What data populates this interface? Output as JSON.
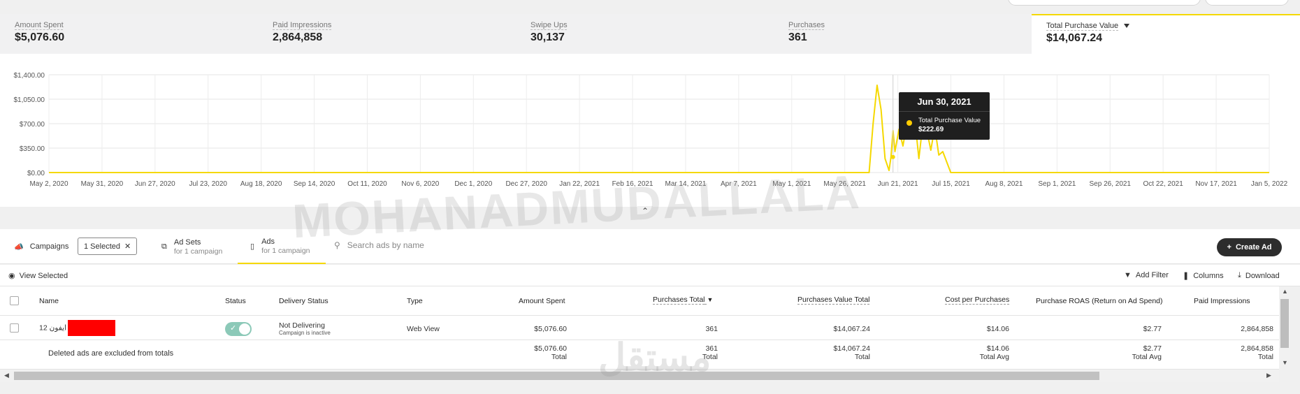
{
  "metrics": [
    {
      "label": "Amount Spent",
      "value": "$5,076.60"
    },
    {
      "label": "Paid Impressions",
      "value": "2,864,858"
    },
    {
      "label": "Swipe Ups",
      "value": "30,137"
    },
    {
      "label": "Purchases",
      "value": "361"
    },
    {
      "label": "Total Purchase Value",
      "value": "$14,067.24"
    }
  ],
  "chart_data": {
    "type": "line",
    "series": [
      {
        "name": "Total Purchase Value",
        "color": "#f5d800"
      }
    ],
    "y_ticks": [
      "$1,400.00",
      "$1,050.00",
      "$700.00",
      "$350.00",
      "$0.00"
    ],
    "ylim": [
      0,
      1400
    ],
    "x_ticks": [
      "May 2, 2020",
      "May 31, 2020",
      "Jun 27, 2020",
      "Jul 23, 2020",
      "Aug 18, 2020",
      "Sep 14, 2020",
      "Oct 11, 2020",
      "Nov 6, 2020",
      "Dec 1, 2020",
      "Dec 27, 2020",
      "Jan 22, 2021",
      "Feb 16, 2021",
      "Mar 14, 2021",
      "Apr 7, 2021",
      "May 1, 2021",
      "May 26, 2021",
      "Jun 21, 2021",
      "Jul 15, 2021",
      "Aug 8, 2021",
      "Sep 1, 2021",
      "Sep 26, 2021",
      "Oct 22, 2021",
      "Nov 17, 2021",
      "Jan 5, 2022"
    ],
    "x": [
      "2021-06-01",
      "2021-06-18",
      "2021-06-20",
      "2021-06-22",
      "2021-06-24",
      "2021-06-26",
      "2021-06-28",
      "2021-06-29",
      "2021-06-30",
      "2021-07-01",
      "2021-07-03",
      "2021-07-05",
      "2021-07-07",
      "2021-07-09",
      "2021-07-11",
      "2021-07-13",
      "2021-07-15",
      "2021-07-17",
      "2021-07-19",
      "2021-07-21",
      "2021-07-23",
      "2021-07-25",
      "2021-07-27",
      "2021-07-29",
      "2021-08-01",
      "2022-01-05"
    ],
    "values": [
      0,
      0,
      700,
      1250,
      900,
      200,
      30,
      222.69,
      600,
      300,
      620,
      380,
      700,
      520,
      750,
      200,
      700,
      600,
      320,
      650,
      250,
      300,
      150,
      0,
      0,
      0
    ],
    "grid": true,
    "tooltip": {
      "date": "Jun 30, 2021",
      "label": "Total Purchase Value",
      "value": "$222.69"
    }
  },
  "tabs": {
    "campaigns": "Campaigns",
    "selected_chip": "1 Selected",
    "adsets_main": "Ad Sets",
    "adsets_sub": "for 1 campaign",
    "ads_main": "Ads",
    "ads_sub": "for 1 campaign",
    "search_placeholder": "Search ads by name",
    "create_ad": "Create Ad"
  },
  "toolbar": {
    "view_selected": "View Selected",
    "add_filter": "Add Filter",
    "columns": "Columns",
    "download": "Download"
  },
  "table": {
    "headers": [
      "Name",
      "Status",
      "Delivery Status",
      "Type",
      "Amount Spent",
      "Purchases Total",
      "Purchases Value Total",
      "Cost per Purchases",
      "Purchase ROAS (Return on Ad Spend)",
      "Paid Impressions"
    ],
    "row": {
      "name": "ايفون 12",
      "delivery": "Not Delivering",
      "delivery_sub": "Campaign is inactive",
      "type": "Web View",
      "amount": "$5,076.60",
      "purchases": "361",
      "value": "$14,067.24",
      "cpp": "$14.06",
      "roas": "$2.77",
      "impressions": "2,864,858"
    },
    "totals": {
      "note": "Deleted ads are excluded from totals",
      "amount": "$5,076.60",
      "amount_sub": "Total",
      "purchases": "361",
      "purchases_sub": "Total",
      "value": "$14,067.24",
      "value_sub": "Total",
      "cpp": "$14.06",
      "cpp_sub": "Total Avg",
      "roas": "$2.77",
      "roas_sub": "Total Avg",
      "impressions": "2,864,858",
      "impressions_sub": "Total"
    }
  },
  "watermarks": {
    "main": "MOHANADMUDALLALA",
    "logo": "مستقل"
  },
  "colors": {
    "accent": "#f5d800",
    "toggle": "#8cc9b8",
    "button": "#2d2d2d"
  }
}
